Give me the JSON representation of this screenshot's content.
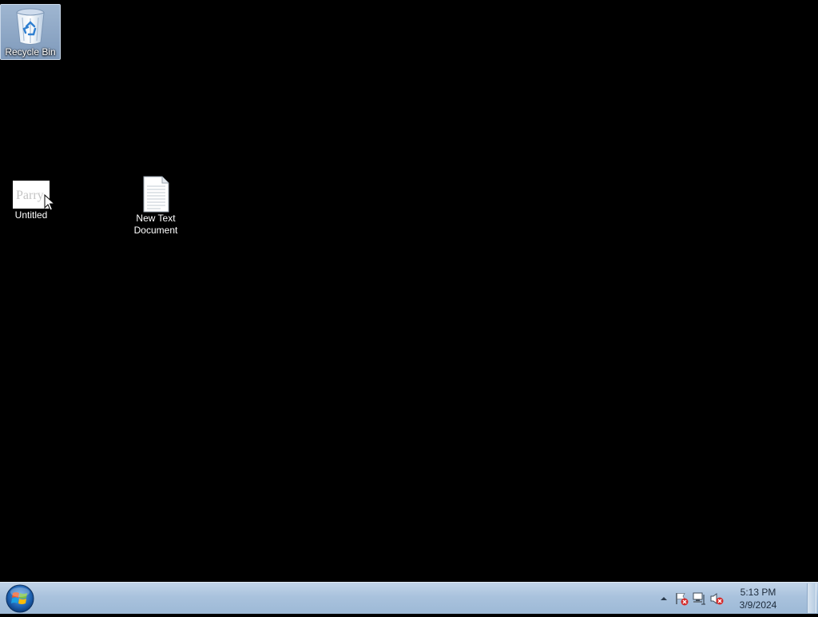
{
  "desktop": {
    "icons": [
      {
        "label": "Recycle Bin",
        "icon": "recycle-bin-icon",
        "selected": true
      },
      {
        "label": "Untitled",
        "icon": "image-thumbnail-icon",
        "thumbnail_text": "Parry"
      },
      {
        "label": "New Text Document",
        "icon": "text-document-icon"
      }
    ]
  },
  "taskbar": {
    "start_icon": "windows-orb-icon",
    "tray": {
      "icons": [
        "show-hidden-icons-arrow",
        "action-center-flag-icon",
        "network-icon",
        "volume-muted-icon"
      ],
      "time": "5:13 PM",
      "date": "3/9/2024"
    }
  },
  "colors": {
    "desktop_background": "#000000",
    "taskbar": "#a9c2dd",
    "selection": "#8ea9c8",
    "error_red": "#d42a2a"
  }
}
